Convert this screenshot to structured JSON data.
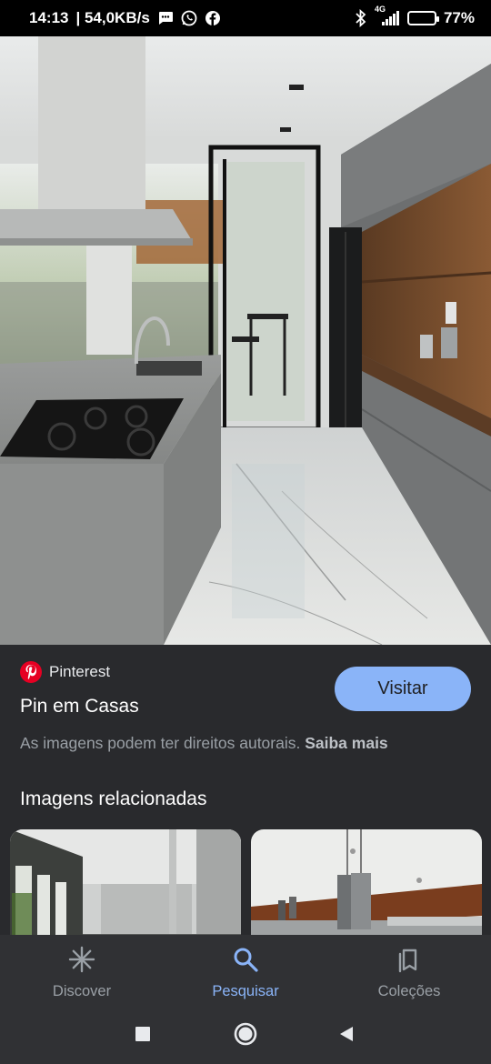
{
  "status_bar": {
    "time": "14:13",
    "speed": "| 54,0KB/s",
    "network": "4G",
    "battery_level": 0.77,
    "battery": "77%",
    "icons": [
      "message-icon",
      "whatsapp-icon",
      "facebook-icon",
      "bluetooth-icon",
      "signal-icon",
      "battery-icon"
    ]
  },
  "pin": {
    "source": "Pinterest",
    "title": "Pin em Casas",
    "visit_label": "Visitar",
    "rights_text": "As imagens podem ter direitos autorais.",
    "learn_more": "Saiba mais"
  },
  "related": {
    "title": "Imagens relacionadas"
  },
  "bottom_nav": {
    "items": [
      {
        "label": "Discover",
        "icon": "asterisk-icon",
        "active": false
      },
      {
        "label": "Pesquisar",
        "icon": "search-icon",
        "active": true
      },
      {
        "label": "Coleções",
        "icon": "bookmarks-icon",
        "active": false
      }
    ]
  },
  "colors": {
    "accent": "#8ab4f8",
    "pinterest": "#e60023",
    "background": "#202124",
    "panel": "#292a2d"
  }
}
